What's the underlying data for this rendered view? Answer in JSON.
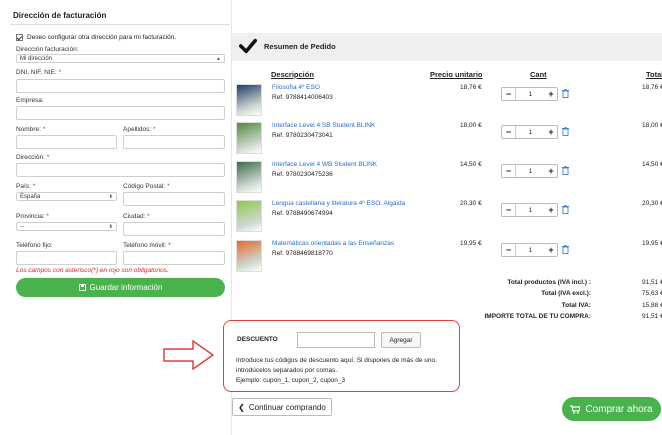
{
  "billing": {
    "title": "Dirección de facturación",
    "same_address_checkbox": "Deseo configurar otra dirección para mi facturación.",
    "address_label": "Dirección facturación:",
    "address_value": "Mi dirección",
    "dni_label": "DNI, NIF, NIE:",
    "empresa_label": "Empresa:",
    "nombre_label": "Nombre:",
    "apellidos_label": "Apellidos:",
    "direccion_label": "Dirección:",
    "pais_label": "País:",
    "pais_value": "España",
    "cp_label": "Código Postal:",
    "provincia_label": "Provincia:",
    "provincia_value": "--",
    "ciudad_label": "Ciudad:",
    "telefono_label": "Teléfono fijo:",
    "movil_label": "Teléfono móvil:",
    "required_note": "Los campos con asterisco(*) en rojo son obligatorios.",
    "save_label": "Guardar información",
    "required_mark": "*"
  },
  "summary": {
    "title": "Resumen de Pedido",
    "headers": {
      "description": "Descripción",
      "unit_price": "Precio unitario",
      "qty": "Cant",
      "total": "Total"
    },
    "products": [
      {
        "name": "Filosofía 4º ESO",
        "ref": "Ref. 9788414006403",
        "price": "18,76 €",
        "qty": "1",
        "total": "18,76 €",
        "thumb_color": "#1f3b6b"
      },
      {
        "name": "Interface Level 4 SB Student BLINK",
        "ref": "Ref. 9780230473041",
        "price": "18,00 €",
        "qty": "1",
        "total": "18,00 €",
        "thumb_color": "#4f8a3c"
      },
      {
        "name": "Interface Level 4 WB Student BLINK",
        "ref": "Ref. 9780230475236",
        "price": "14,50 €",
        "qty": "1",
        "total": "14,50 €",
        "thumb_color": "#3b6b4a"
      },
      {
        "name": "Lengua castellana y literatura 4º ESO. Algaida",
        "ref": "Ref. 9788490674994",
        "price": "20,30 €",
        "qty": "1",
        "total": "20,30 €",
        "thumb_color": "#8fc84b"
      },
      {
        "name": "Matemáticas orientadas a las Enseñanzas",
        "ref": "Ref. 9788469818770",
        "price": "19,95 €",
        "qty": "1",
        "total": "19,95 €",
        "thumb_color": "#e46a2b"
      }
    ],
    "totals": [
      {
        "label": "Total productos  (IVA incl.) :",
        "value": "91,51 €"
      },
      {
        "label": "Total  (IVA excl.):",
        "value": "75,63 €"
      },
      {
        "label": "Total IVA:",
        "value": "15,88 €"
      },
      {
        "label": "IMPORTE TOTAL DE TU COMPRA:",
        "value": "91,51 €"
      }
    ]
  },
  "discount": {
    "title": "DESCUENTO",
    "button": "Agregar",
    "input_value": "",
    "line1": "Introduce tus códigos de descuento aquí. Si dispones de más de uno,",
    "line2": "introdúcelos separados por comas.",
    "line3": "Ejemplo: cupon_1, cupon_2, cupon_3"
  },
  "actions": {
    "continue": "Continuar comprando",
    "buy": "Comprar ahora"
  },
  "colors": {
    "green": "#49b24d",
    "red": "#e0413a",
    "link": "#2a6bd0"
  }
}
